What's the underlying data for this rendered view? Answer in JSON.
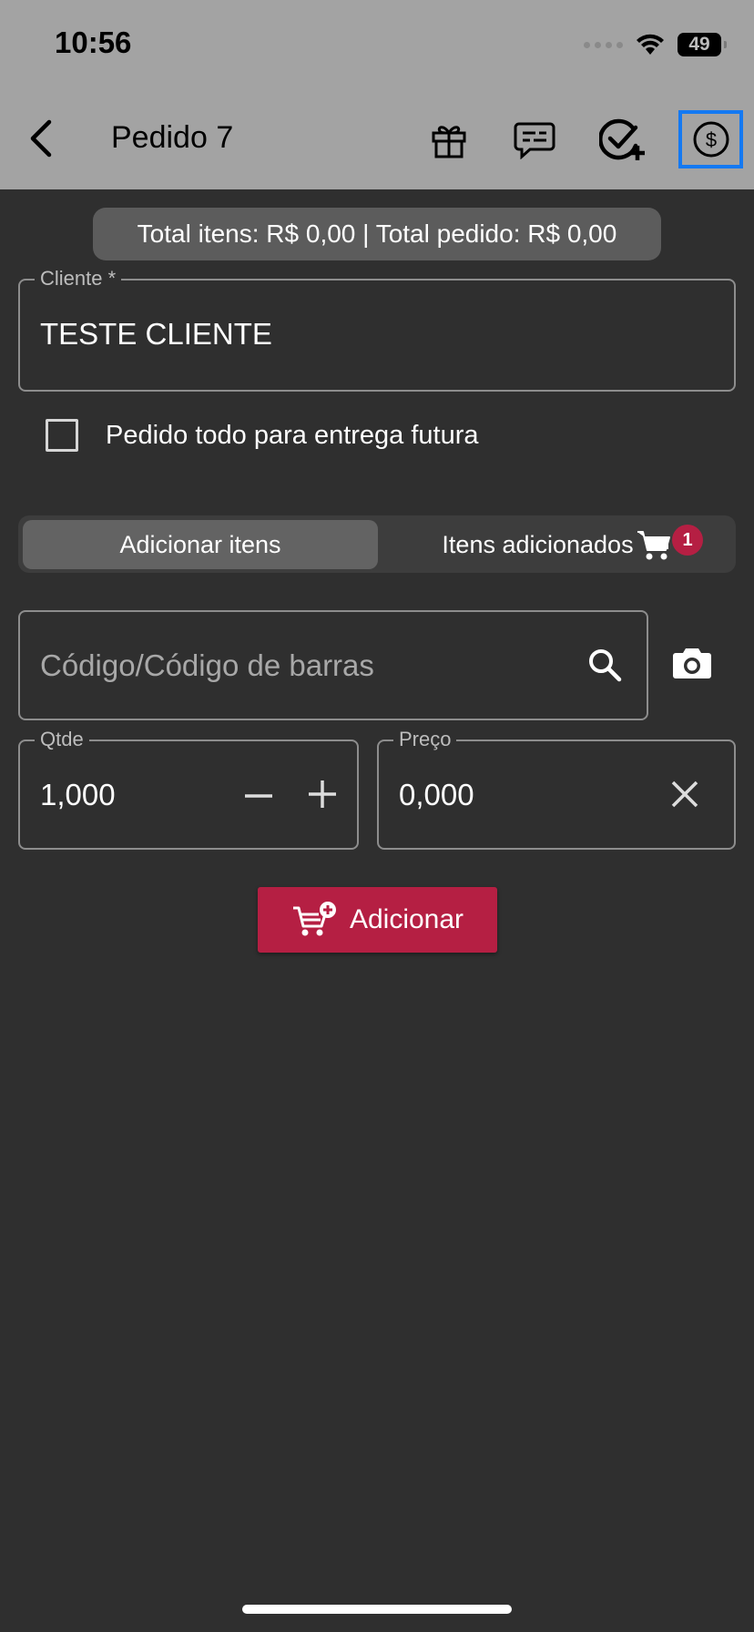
{
  "status_bar": {
    "time": "10:56",
    "battery": "49"
  },
  "header": {
    "title": "Pedido 7",
    "back_icon": "chevron-left-icon",
    "actions": [
      "gift-icon",
      "chat-icon",
      "check-plus-icon",
      "dollar-circle-icon"
    ],
    "highlight_color": "#1479f2"
  },
  "totals": {
    "text": "Total itens: R$ 0,00 | Total pedido: R$ 0,00"
  },
  "client": {
    "label": "Cliente *",
    "value": "TESTE CLIENTE"
  },
  "future_delivery": {
    "label": "Pedido todo para entrega futura",
    "checked": false
  },
  "tabs": {
    "add_items": "Adicionar itens",
    "added_items": "Itens adicionados",
    "added_count": "1"
  },
  "code_search": {
    "placeholder": "Código/Código de barras"
  },
  "quantity": {
    "label": "Qtde",
    "value": "1,000"
  },
  "price": {
    "label": "Preço",
    "value": "0,000"
  },
  "add_button": {
    "label": "Adicionar",
    "color": "#b51f43"
  },
  "colors": {
    "topbar": "#a3a3a3",
    "background": "#2f2f2f"
  }
}
